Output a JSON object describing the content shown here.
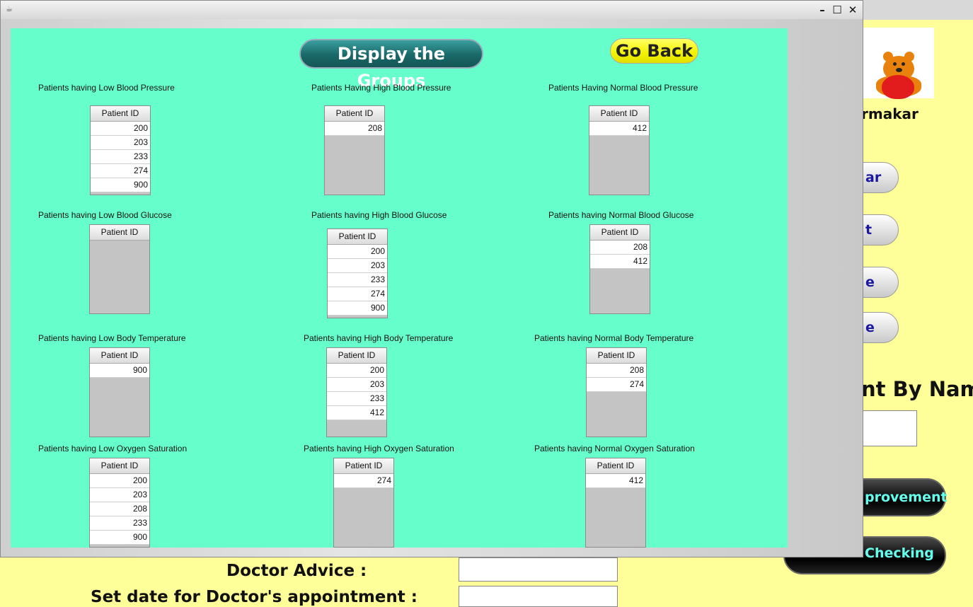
{
  "background_app": {
    "name_fragment": "rmakar",
    "nav_buttons": [
      "ar",
      "t",
      "e",
      "e"
    ],
    "search_heading": "nt By Name",
    "improvement_button": "provement",
    "checking_button": "Checking",
    "doctor_advice_label": "Doctor Advice :",
    "appointment_label": "Set date for Doctor's appointment :"
  },
  "window": {
    "minimize": "–",
    "maximize": "☐",
    "close": "✕"
  },
  "toolbar": {
    "display_label": "Display the Groups",
    "back_label": "Go Back"
  },
  "groups": [
    {
      "title": "Patients having Low Blood Pressure",
      "header": "Patient ID",
      "ids": [
        "200",
        "203",
        "233",
        "274",
        "900"
      ]
    },
    {
      "title": "Patients Having High Blood Pressure",
      "header": "Patient ID",
      "ids": [
        "208"
      ]
    },
    {
      "title": "Patients Having Normal Blood Pressure",
      "header": "Patient ID",
      "ids": [
        "412"
      ]
    },
    {
      "title": "Patients having Low Blood Glucose",
      "header": "Patient ID",
      "ids": []
    },
    {
      "title": "Patients having High Blood Glucose",
      "header": "Patient ID",
      "ids": [
        "200",
        "203",
        "233",
        "274",
        "900"
      ]
    },
    {
      "title": "Patients having Normal Blood Glucose",
      "header": "Patient ID",
      "ids": [
        "208",
        "412"
      ]
    },
    {
      "title": "Patients having Low Body Temperature",
      "header": "Patient ID",
      "ids": [
        "900"
      ]
    },
    {
      "title": "Patients having High Body Temperature",
      "header": "Patient ID",
      "ids": [
        "200",
        "203",
        "233",
        "412"
      ]
    },
    {
      "title": "Patients having Normal Body Temperature",
      "header": "Patient ID",
      "ids": [
        "208",
        "274"
      ]
    },
    {
      "title": "Patients having Low Oxygen Saturation",
      "header": "Patient ID",
      "ids": [
        "200",
        "203",
        "208",
        "233",
        "900"
      ]
    },
    {
      "title": "Patients having High Oxygen Saturation",
      "header": "Patient ID",
      "ids": [
        "274"
      ]
    },
    {
      "title": "Patients having Normal Oxygen Saturation",
      "header": "Patient ID",
      "ids": [
        "412"
      ]
    }
  ]
}
